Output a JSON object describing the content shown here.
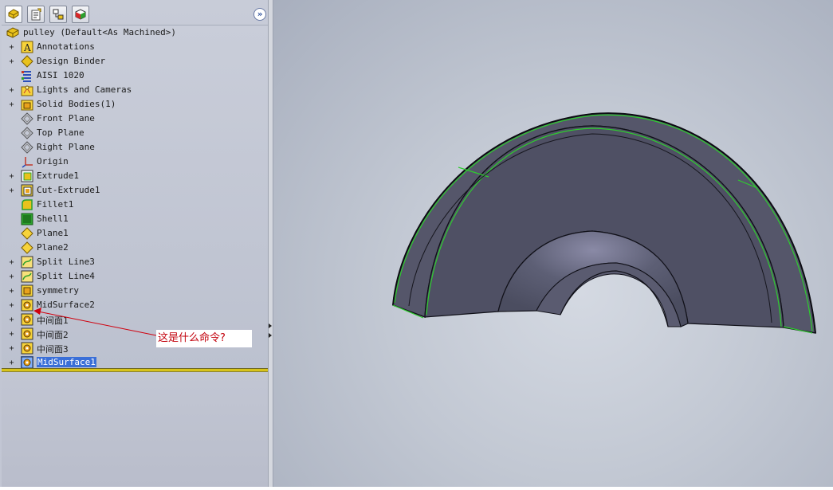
{
  "tabs": [
    {
      "icon": "feature-manager-icon",
      "active": true
    },
    {
      "icon": "property-manager-icon",
      "active": false
    },
    {
      "icon": "configuration-manager-icon",
      "active": false
    },
    {
      "icon": "display-manager-icon",
      "active": false
    }
  ],
  "collapse_glyph": "»",
  "tree": {
    "root": {
      "label": "pulley  (Default<As Machined>)",
      "icon": "part-icon"
    },
    "items": [
      {
        "label": "Annotations",
        "icon": "annotations-icon",
        "expander": "+"
      },
      {
        "label": "Design Binder",
        "icon": "design-binder-icon",
        "expander": "+"
      },
      {
        "label": "AISI 1020",
        "icon": "material-icon",
        "expander": ""
      },
      {
        "label": "Lights and Cameras",
        "icon": "lights-cameras-icon",
        "expander": "+"
      },
      {
        "label": "Solid Bodies(1)",
        "icon": "solid-bodies-icon",
        "expander": "+"
      },
      {
        "label": "Front Plane",
        "icon": "plane-icon",
        "expander": ""
      },
      {
        "label": "Top Plane",
        "icon": "plane-icon",
        "expander": ""
      },
      {
        "label": "Right Plane",
        "icon": "plane-icon",
        "expander": ""
      },
      {
        "label": "Origin",
        "icon": "origin-icon",
        "expander": ""
      },
      {
        "label": "Extrude1",
        "icon": "extrude-icon",
        "expander": "+"
      },
      {
        "label": "Cut-Extrude1",
        "icon": "cut-extrude-icon",
        "expander": "+"
      },
      {
        "label": "Fillet1",
        "icon": "fillet-icon",
        "expander": ""
      },
      {
        "label": "Shell1",
        "icon": "shell-icon",
        "expander": ""
      },
      {
        "label": "Plane1",
        "icon": "ref-plane-icon",
        "expander": ""
      },
      {
        "label": "Plane2",
        "icon": "ref-plane-icon",
        "expander": ""
      },
      {
        "label": "Split Line3",
        "icon": "split-line-icon",
        "expander": "+"
      },
      {
        "label": "Split Line4",
        "icon": "split-line-icon",
        "expander": "+"
      },
      {
        "label": "symmetry",
        "icon": "sketch-feature-icon",
        "expander": "+"
      },
      {
        "label": "MidSurface2",
        "icon": "midsurface-icon",
        "expander": "+"
      },
      {
        "label": "中间面1",
        "icon": "midsurface-icon",
        "expander": "+"
      },
      {
        "label": "中间面2",
        "icon": "midsurface-icon",
        "expander": "+"
      },
      {
        "label": "中间面3",
        "icon": "midsurface-icon",
        "expander": "+"
      },
      {
        "label": "MidSurface1",
        "icon": "midsurface-icon",
        "expander": "+",
        "selected": true
      }
    ]
  },
  "annotation": {
    "text": "这是什么命令?",
    "color": "#c2000b"
  },
  "colors": {
    "accent_selection": "#3a6fd8",
    "rollback_bar": "#d7c31a",
    "edge_highlight": "#2ecc2e",
    "part_face": "#55566a"
  }
}
